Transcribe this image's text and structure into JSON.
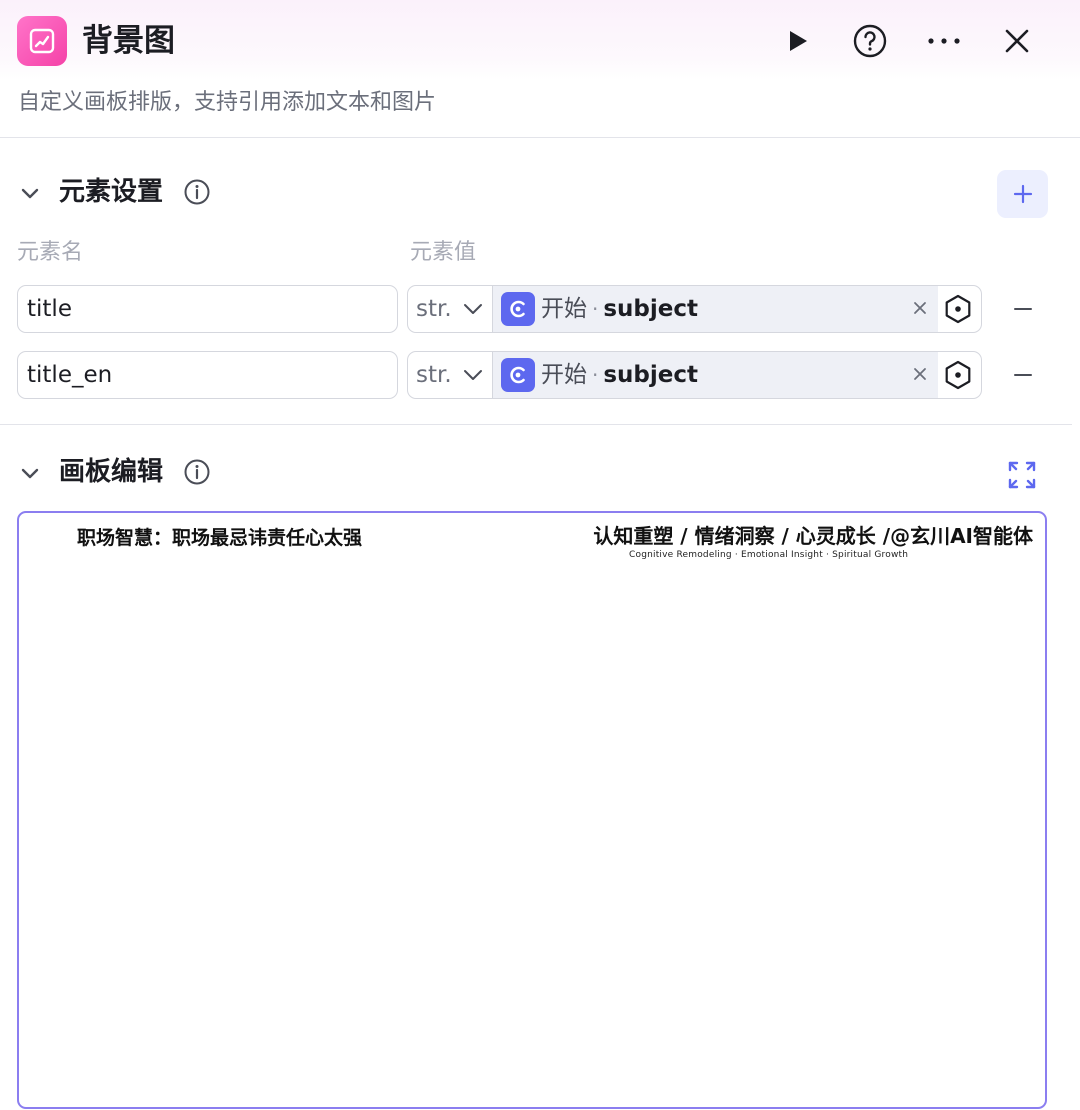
{
  "header": {
    "title": "背景图",
    "description": "自定义画板排版，支持引用添加文本和图片"
  },
  "colors": {
    "accent": "#5d68ef",
    "app_icon": "#f542a8",
    "canvas_border": "#8b7ef0"
  },
  "elements_section": {
    "title": "元素设置",
    "col_name_label": "元素名",
    "col_value_label": "元素值",
    "rows": [
      {
        "name": "title",
        "type": "str.",
        "ref_node": "开始",
        "ref_var": "subject"
      },
      {
        "name": "title_en",
        "type": "str.",
        "ref_node": "开始",
        "ref_var": "subject"
      }
    ]
  },
  "canvas_section": {
    "title": "画板编辑",
    "canvas": {
      "title_text": "职场智慧：职场最忌讳责任心太强",
      "tagline": "认知重塑 / 情绪洞察 / 心灵成长 /@玄川AI智能体",
      "subline": "Cognitive Remodeling  ·  Emotional Insight  ·  Spiritual Growth"
    }
  }
}
